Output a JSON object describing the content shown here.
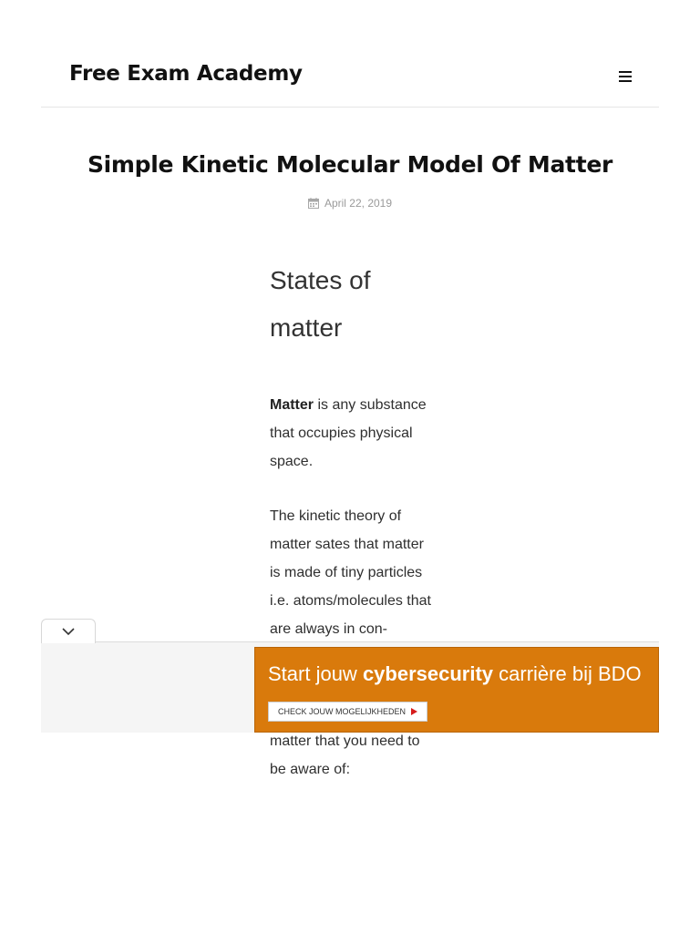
{
  "header": {
    "site_title": "Free Exam Academy",
    "menu_icon": "hamburger-icon"
  },
  "post": {
    "title": "Simple Kinetic Molecular Model Of Matter",
    "date": "April 22, 2019",
    "date_icon": "calendar-icon"
  },
  "article": {
    "heading_line1": "States of",
    "heading_line2": "matter",
    "p1_bold": "Matter",
    "p1_text": " is any substance that occupies physical space.",
    "p2": "The kinetic theory of matter sates that matter is made of tiny particles i.e. atoms/molecules that are always in con-",
    "p3": "matter that you need to be aware of:"
  },
  "ad": {
    "collapse_icon": "chevron-down-icon",
    "headline_pre": "Start jouw ",
    "headline_bold": "cybersecurity",
    "headline_post": " carrière bij BDO",
    "cta_label": "CHECK JOUW MOGELIJKHEDEN",
    "cta_icon": "play-arrow-icon",
    "banner_color": "#d97a0c"
  }
}
